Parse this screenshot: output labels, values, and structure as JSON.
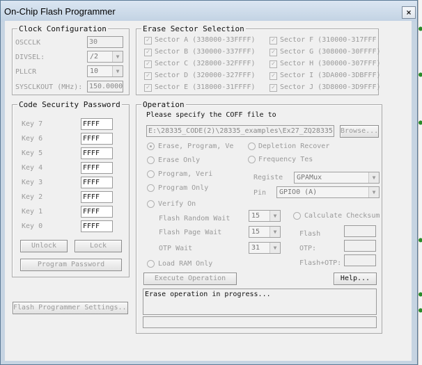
{
  "window": {
    "title": "On-Chip Flash Programmer",
    "close_glyph": "×"
  },
  "clock": {
    "legend": "Clock Configuration",
    "osc_label": "OSCCLK",
    "osc_value": "30",
    "divsel_label": "DIVSEL:",
    "divsel_value": "/2",
    "pllcr_label": "PLLCR",
    "pllcr_value": "10",
    "sysclk_label": "SYSCLKOUT (MHz):",
    "sysclk_value": "150.0000"
  },
  "erase": {
    "legend": "Erase Sector Selection",
    "sectors_left": [
      {
        "label": "Sector A (338000-33FFFF)",
        "checked": true
      },
      {
        "label": "Sector B (330000-337FFF)",
        "checked": true
      },
      {
        "label": "Sector C (328000-32FFFF)",
        "checked": true
      },
      {
        "label": "Sector D (320000-327FFF)",
        "checked": true
      },
      {
        "label": "Sector E (318000-31FFFF)",
        "checked": true
      }
    ],
    "sectors_right": [
      {
        "label": "Sector F (310000-317FFF",
        "checked": true
      },
      {
        "label": "Sector G (308000-30FFFF)",
        "checked": true
      },
      {
        "label": "Sector H (300000-307FFF)",
        "checked": true
      },
      {
        "label": "Sector I (3DA000-3DBFFF)",
        "checked": true
      },
      {
        "label": "Sector J (3D8000-3D9FFF)",
        "checked": true
      }
    ]
  },
  "security": {
    "legend": "Code Security Password",
    "keys": [
      {
        "label": "Key 7",
        "value": "FFFF"
      },
      {
        "label": "Key 6",
        "value": "FFFF"
      },
      {
        "label": "Key 5",
        "value": "FFFF"
      },
      {
        "label": "Key 4",
        "value": "FFFF"
      },
      {
        "label": "Key 3",
        "value": "FFFF"
      },
      {
        "label": "Key 2",
        "value": "FFFF"
      },
      {
        "label": "Key 1",
        "value": "FFFF"
      },
      {
        "label": "Key 0",
        "value": "FFFF"
      }
    ],
    "unlock_label": "Unlock",
    "lock_label": "Lock",
    "program_password_label": "Program Password"
  },
  "settings_button": "Flash Programmer Settings...",
  "operation": {
    "legend": "Operation",
    "coff_prompt": "Please specify the COFF file to",
    "coff_path": "E:\\28335_CODE(2)\\28335_examples\\Ex27_ZQ28335",
    "browse_label": "Browse...",
    "modes": [
      {
        "label": "Erase, Program, Ve",
        "selected": true
      },
      {
        "label": "Erase Only",
        "selected": false
      },
      {
        "label": "Program, Veri",
        "selected": false
      },
      {
        "label": "Program Only",
        "selected": false
      },
      {
        "label": "Verify On",
        "selected": false
      }
    ],
    "depletion_label": "Depletion Recover",
    "frequency_label": "Frequency Tes",
    "register_label": "Registe",
    "register_value": "GPAMux",
    "pin_label": "Pin",
    "pin_value": "GPIO0 (A)",
    "random_wait_label": "Flash Random Wait",
    "random_wait_value": "15",
    "page_wait_label": "Flash Page Wait",
    "page_wait_value": "15",
    "otp_wait_label": "OTP Wait",
    "otp_wait_value": "31",
    "checksum_label": "Calculate Checksum",
    "flash_label": "Flash",
    "otp_label": "OTP:",
    "flash_otp_label": "Flash+OTP:",
    "load_ram_label": "Load RAM Only",
    "execute_label": "Execute Operation",
    "help_label": "Help...",
    "status_text": "Erase operation in progress..."
  }
}
